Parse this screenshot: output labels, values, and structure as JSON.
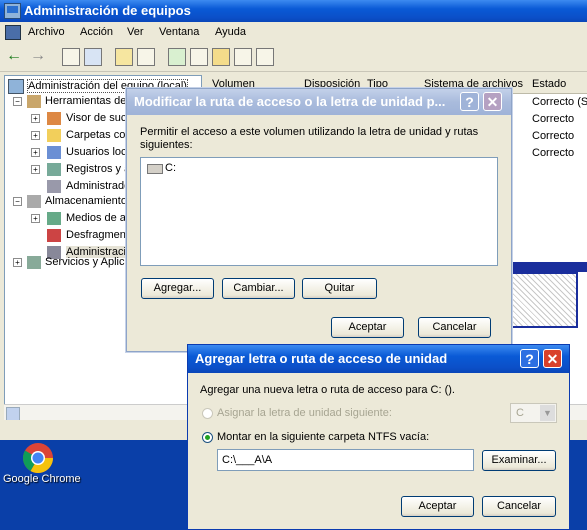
{
  "main_window": {
    "title": "Administración de equipos",
    "menu": [
      "Archivo",
      "Acción",
      "Ver",
      "Ventana",
      "Ayuda"
    ],
    "tree": {
      "root": "Administración del equipo (local)",
      "tools": "Herramientas de...",
      "tool_items": [
        "Visor de suce...",
        "Carpetas com...",
        "Usuarios loca...",
        "Registros y a...",
        "Administrado..."
      ],
      "storage": "Almacenamiento",
      "storage_items": [
        "Medios de al...",
        "Desfragment...",
        "Administracio..."
      ],
      "services": "Servicios y Aplica..."
    },
    "columns": [
      "Volumen",
      "Disposición",
      "Tipo",
      "Sistema de archivos",
      "Estado"
    ],
    "status_values": [
      "Correcto (S",
      "Correcto",
      "Correcto",
      "Correcto"
    ]
  },
  "desktop": {
    "chrome_label": "Google Chrome"
  },
  "dialog_modify": {
    "title": "Modificar la ruta de acceso o la letra de unidad p...",
    "description": "Permitir el acceso a este volumen utilizando la letra de unidad y rutas siguientes:",
    "list_items": [
      "C:"
    ],
    "buttons": {
      "add": "Agregar...",
      "change": "Cambiar...",
      "remove": "Quitar",
      "ok": "Aceptar",
      "cancel": "Cancelar"
    }
  },
  "dialog_add": {
    "title": "Agregar letra o ruta de acceso de unidad",
    "description": "Agregar una nueva letra o ruta de acceso para C: ().",
    "option_assign": "Asignar la letra de unidad siguiente:",
    "drive_letter": "C",
    "option_mount": "Montar en la siguiente carpeta NTFS vacía:",
    "path_value": "C:\\___A\\A",
    "buttons": {
      "browse": "Examinar...",
      "ok": "Aceptar",
      "cancel": "Cancelar"
    }
  },
  "colors": {
    "xp_blue": "#0a5ad6",
    "inactive_title": "#a9bbdc",
    "close_red": "#d9402b"
  }
}
